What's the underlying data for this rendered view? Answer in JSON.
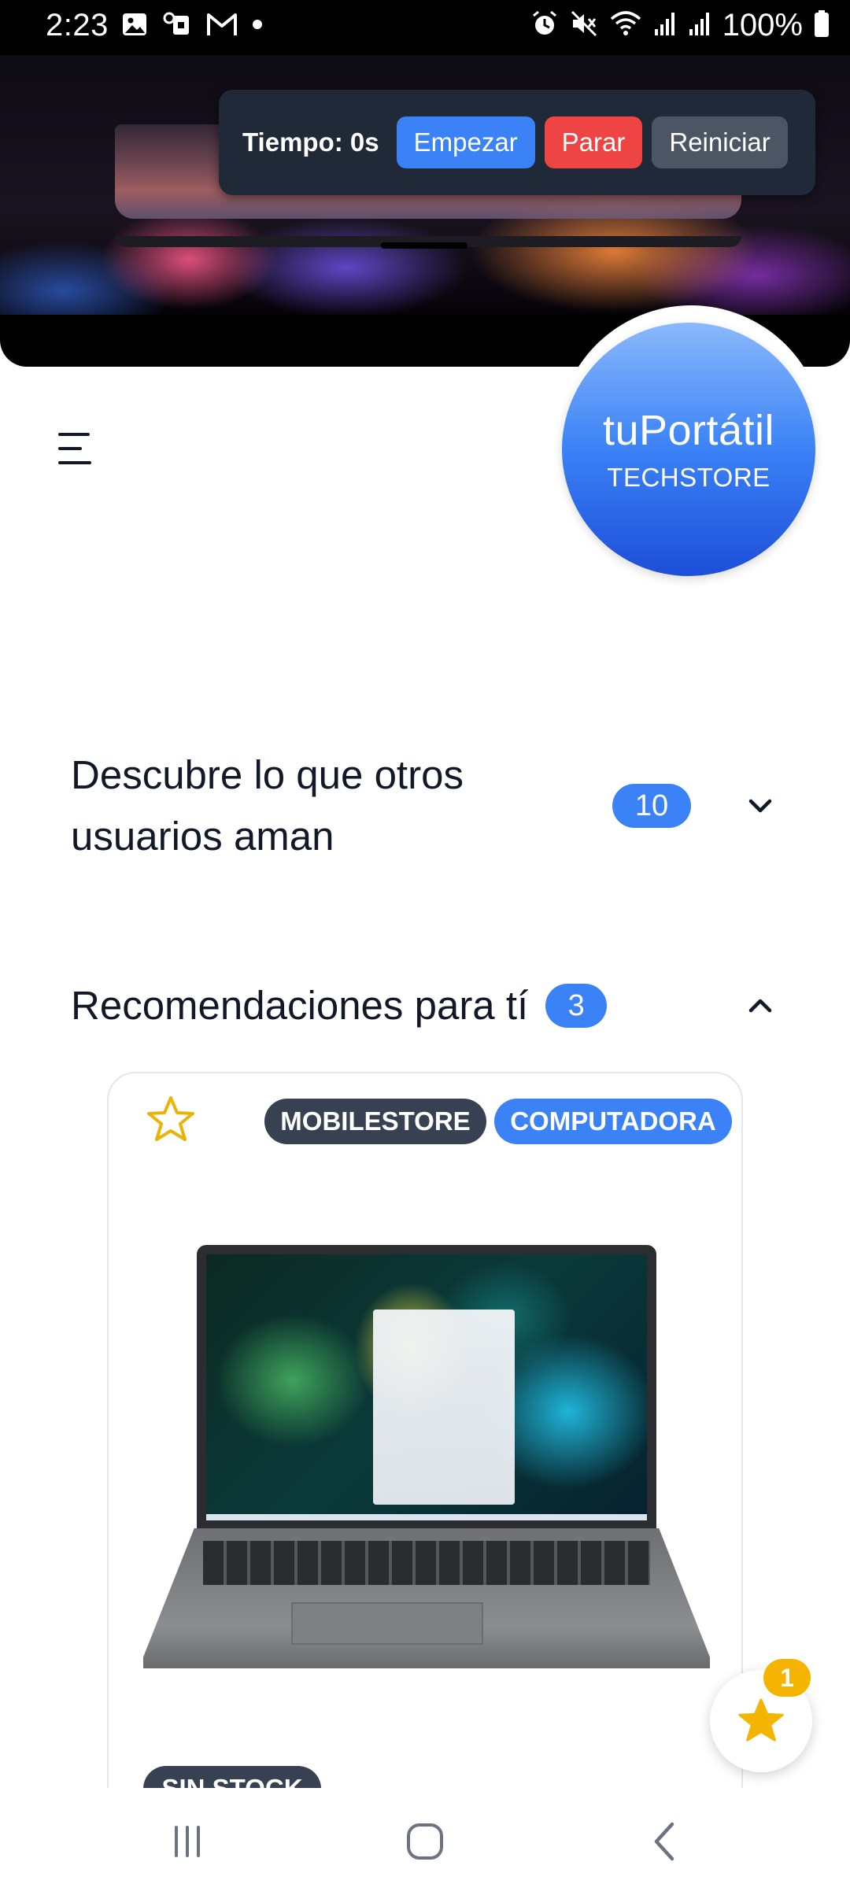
{
  "status_bar": {
    "time": "2:23",
    "battery": "100%",
    "left_icons": [
      "image-icon",
      "key-icon",
      "gmail-icon",
      "dot-icon"
    ],
    "right_icons": [
      "alarm-icon",
      "mute-icon",
      "wifi-icon",
      "signal-icon",
      "signal-icon",
      "battery-icon"
    ]
  },
  "timer": {
    "label": "Tiempo: 0s",
    "start": "Empezar",
    "stop": "Parar",
    "reset": "Reiniciar"
  },
  "logo": {
    "title": "tuPortátil",
    "subtitle": "TECHSTORE"
  },
  "sections": [
    {
      "title": "Descubre lo que otros usuarios aman",
      "count": "10",
      "expanded": false
    },
    {
      "title": "Recomendaciones para tí",
      "count": "3",
      "expanded": true
    }
  ],
  "product": {
    "store": "MOBILESTORE",
    "category": "COMPUTADORA",
    "stock": "SIN STOCK",
    "favorite": false
  },
  "favorites": {
    "count": "1"
  },
  "colors": {
    "primary": "#3b82f6",
    "danger": "#ef4444",
    "dark": "#374151",
    "star": "#f5b400"
  }
}
